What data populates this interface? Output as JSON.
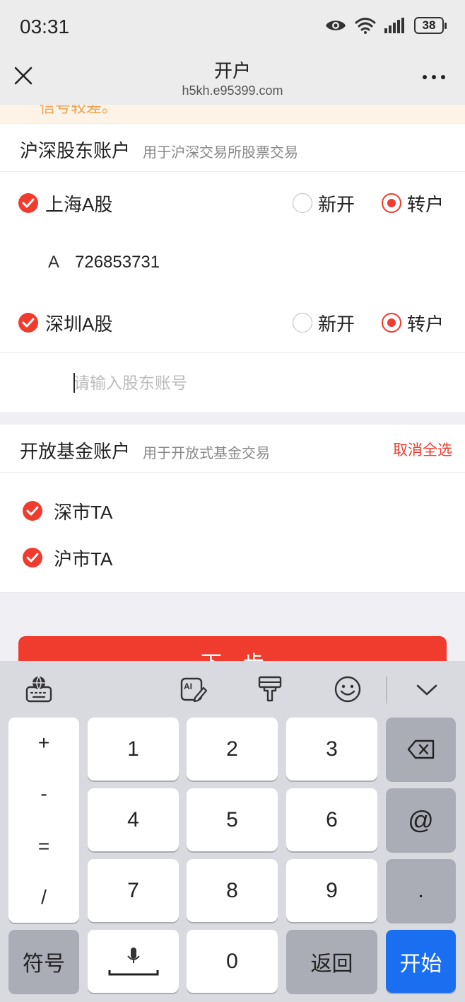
{
  "status": {
    "time": "03:31",
    "battery": "38"
  },
  "nav": {
    "title": "开户",
    "url": "h5kh.e95399.com"
  },
  "notice": {
    "text": "信号较差。"
  },
  "section1": {
    "title": "沪深股东账户",
    "desc": "用于沪深交易所股票交易",
    "rows": [
      {
        "label": "上海A股",
        "opt_new": "新开",
        "opt_transfer": "转户"
      },
      {
        "label": "深圳A股",
        "opt_new": "新开",
        "opt_transfer": "转户"
      }
    ],
    "account_prefix": "A",
    "account_value": "726853731",
    "input_placeholder": "请输入股东账号"
  },
  "section2": {
    "title": "开放基金账户",
    "desc": "用于开放式基金交易",
    "action": "取消全选",
    "items": [
      "深市TA",
      "沪市TA"
    ]
  },
  "next_button": "下一步",
  "keyboard": {
    "symbols": [
      "+",
      "-",
      "=",
      "/"
    ],
    "digits": [
      "1",
      "2",
      "3",
      "4",
      "5",
      "6",
      "7",
      "8",
      "9",
      "0"
    ],
    "at": "@",
    "dot": ".",
    "symbols_key": "符号",
    "back_key": "返回",
    "go_key": "开始"
  },
  "colors": {
    "accent": "#f03c2e",
    "go": "#1a6ff0"
  }
}
